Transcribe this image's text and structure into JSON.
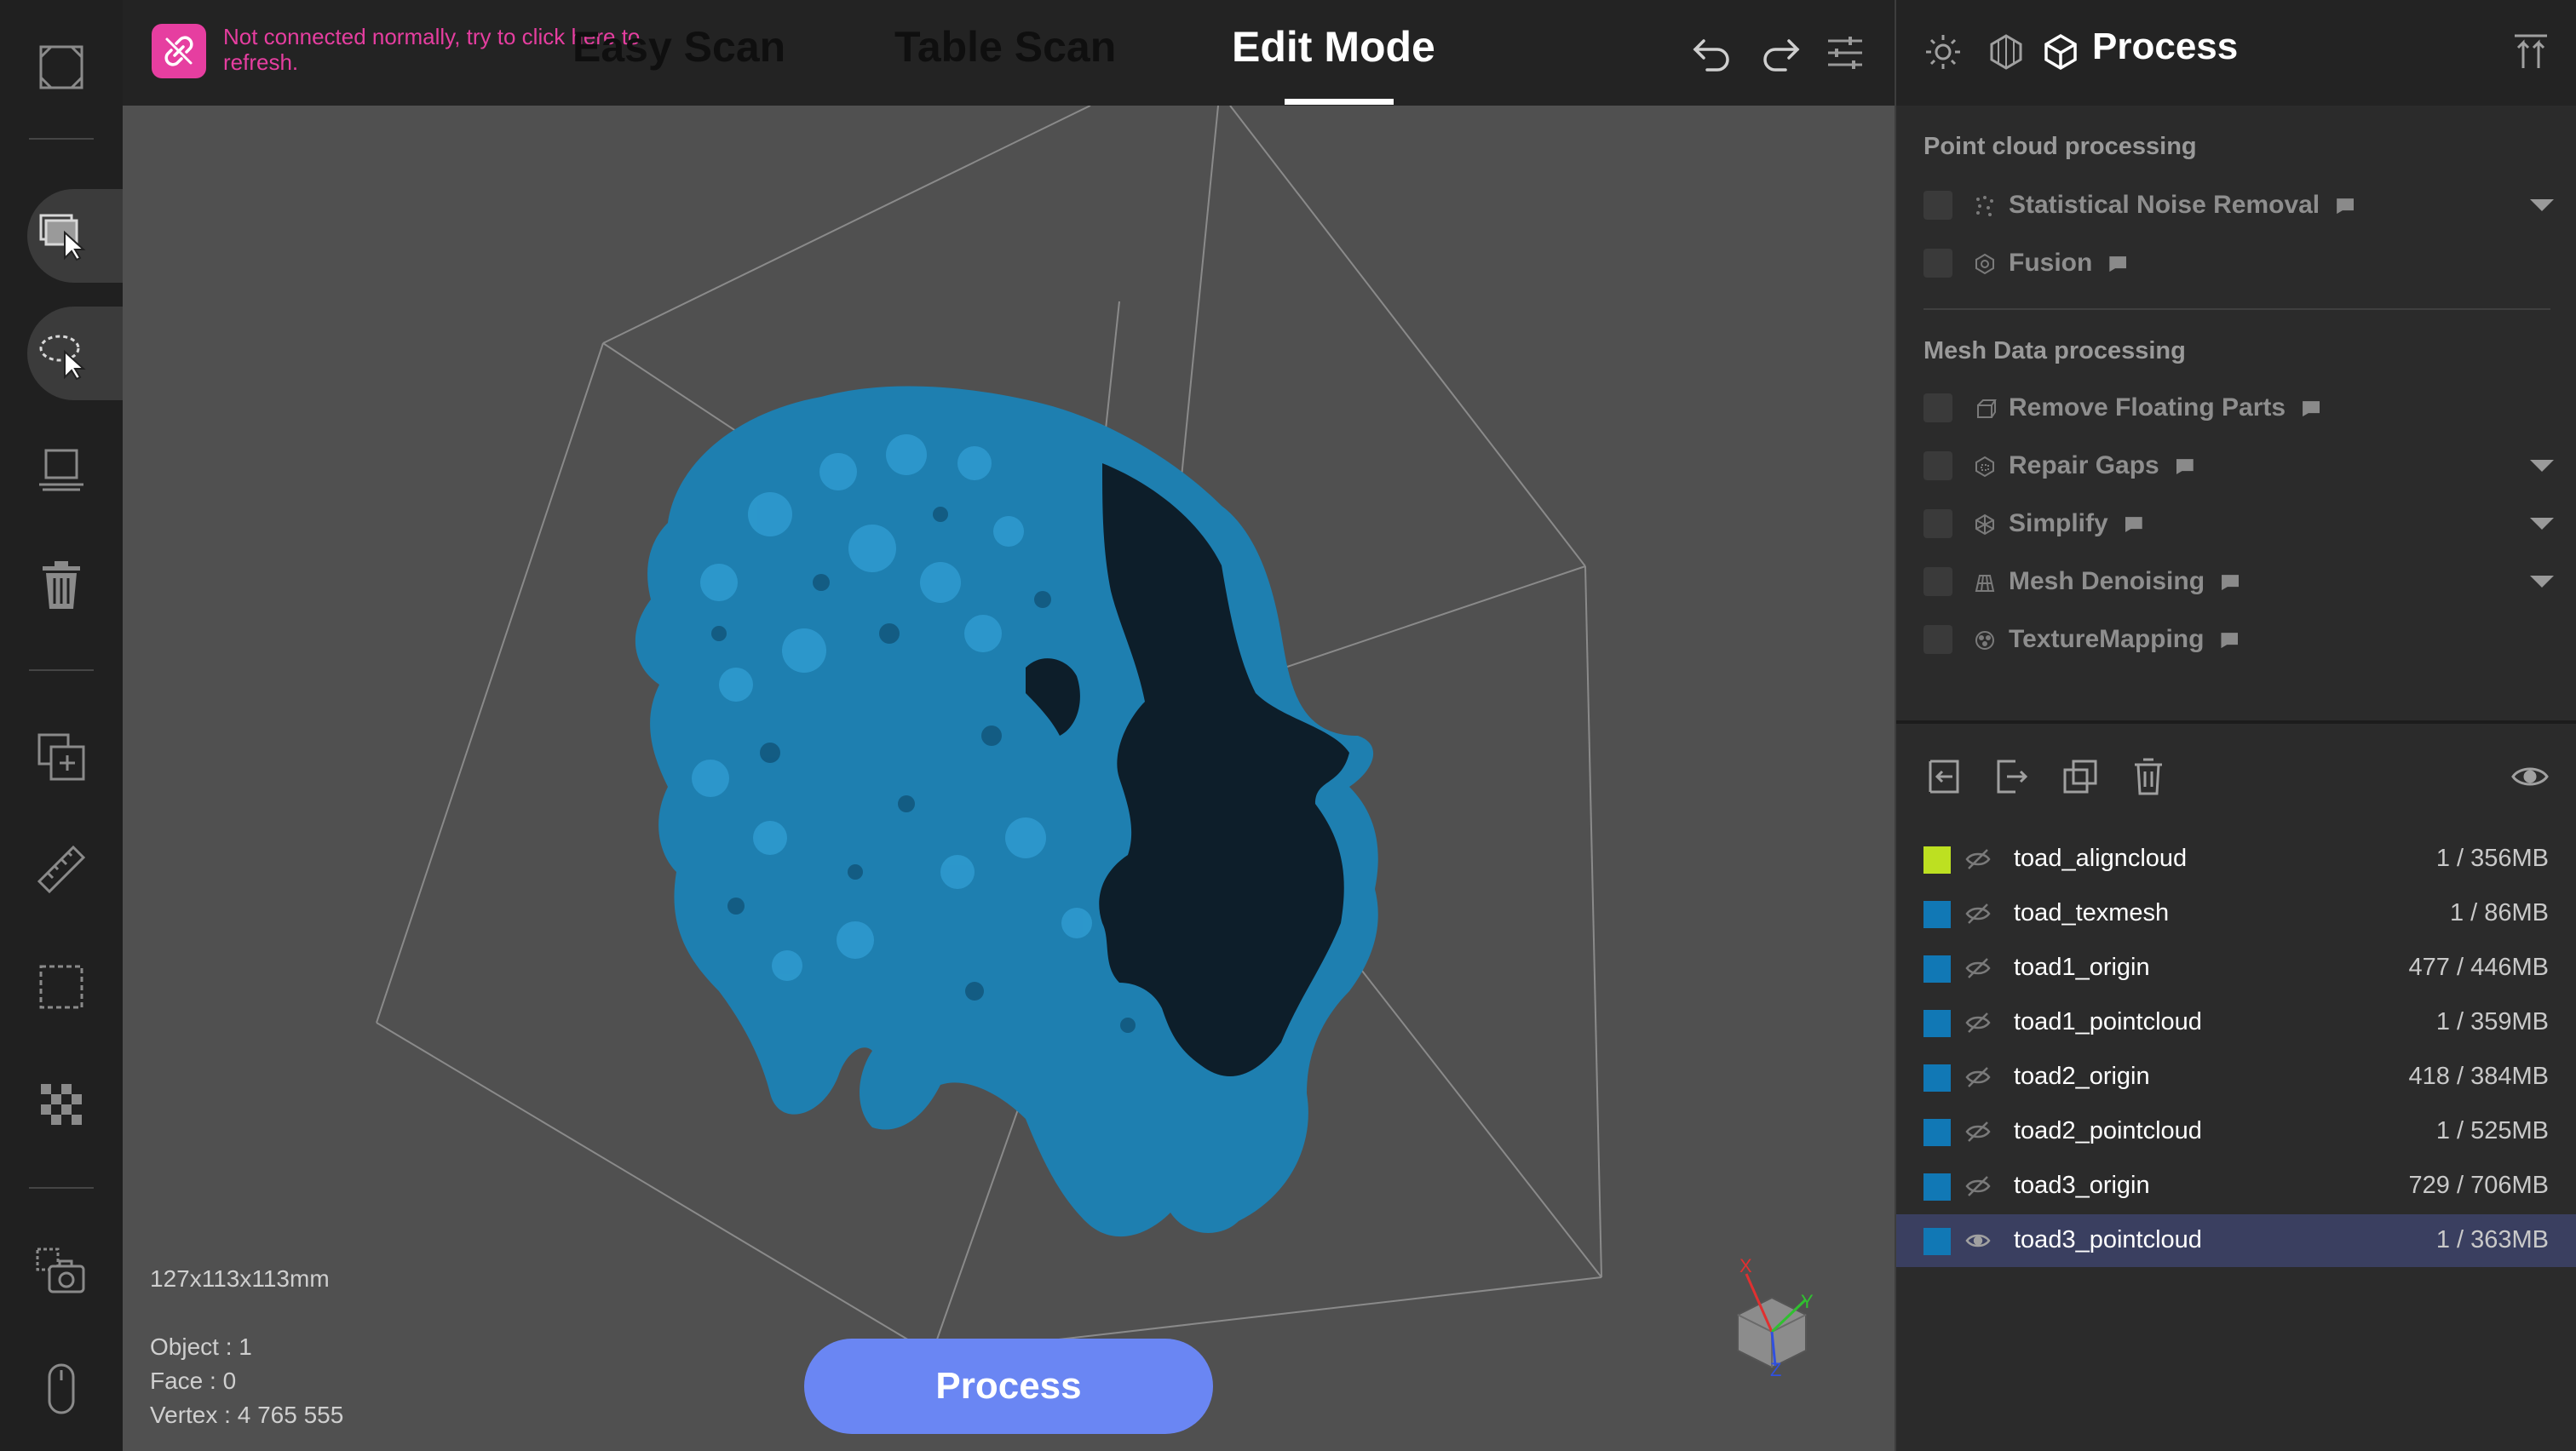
{
  "connection": {
    "message": "Not connected normally, try to click here to refresh.",
    "icon": "broken-link-icon",
    "color": "#e63ea0"
  },
  "modes": {
    "easy_scan": "Easy Scan",
    "table_scan": "Table Scan",
    "edit_mode": "Edit Mode",
    "active": "Edit Mode"
  },
  "toolbar": {
    "icons": [
      "fit-view-icon",
      "select-icon",
      "lasso-select-icon",
      "plane-cut-icon",
      "delete-icon",
      "add-layer-icon",
      "ruler-icon",
      "crop-box-icon",
      "checkerboard-icon",
      "snapshot-icon",
      "mouse-icon"
    ],
    "top_icons": [
      "undo-icon",
      "redo-icon",
      "settings-sliders-icon"
    ]
  },
  "viewport": {
    "dimensions": "127x113x113mm",
    "object_label": "Object : 1",
    "face_label": "Face : 0",
    "vertex_label": "Vertex : 4 765 555",
    "process_button": "Process",
    "model_color": "#1e7fb0",
    "background": "#505050",
    "axes": {
      "x": "X",
      "y": "Y",
      "z": "Z"
    }
  },
  "panel": {
    "title": "Process",
    "header_icons": [
      "sun-icon",
      "texture-icon",
      "cube-icon",
      "upload-icon"
    ],
    "point_cloud": {
      "title": "Point cloud processing",
      "items": [
        {
          "label": "Statistical Noise Removal",
          "icon": "noise-icon",
          "has_dropdown": true
        },
        {
          "label": "Fusion",
          "icon": "fusion-icon",
          "has_dropdown": false
        }
      ]
    },
    "mesh": {
      "title": "Mesh Data processing",
      "items": [
        {
          "label": "Remove Floating Parts",
          "icon": "floating-parts-icon",
          "has_dropdown": false
        },
        {
          "label": "Repair Gaps",
          "icon": "repair-gaps-icon",
          "has_dropdown": true
        },
        {
          "label": "Simplify",
          "icon": "simplify-icon",
          "has_dropdown": true
        },
        {
          "label": "Mesh Denoising",
          "icon": "mesh-denoise-icon",
          "has_dropdown": true
        },
        {
          "label": "TextureMapping",
          "icon": "texture-mapping-icon",
          "has_dropdown": false
        }
      ]
    },
    "object_actions": [
      "import-icon",
      "export-icon",
      "duplicate-icon",
      "trash-icon",
      "eye-icon"
    ],
    "layers": [
      {
        "name": "toad_aligncloud",
        "size": "1 / 356MB",
        "color": "#bde021",
        "visible": false
      },
      {
        "name": "toad_texmesh",
        "size": "1 / 86MB",
        "color": "#1178b5",
        "visible": false
      },
      {
        "name": "toad1_origin",
        "size": "477 / 446MB",
        "color": "#1178b5",
        "visible": false
      },
      {
        "name": "toad1_pointcloud",
        "size": "1 / 359MB",
        "color": "#1178b5",
        "visible": false
      },
      {
        "name": "toad2_origin",
        "size": "418 / 384MB",
        "color": "#1178b5",
        "visible": false
      },
      {
        "name": "toad2_pointcloud",
        "size": "1 / 525MB",
        "color": "#1178b5",
        "visible": false
      },
      {
        "name": "toad3_origin",
        "size": "729 / 706MB",
        "color": "#1178b5",
        "visible": false
      },
      {
        "name": "toad3_pointcloud",
        "size": "1 / 363MB",
        "color": "#1178b5",
        "visible": true,
        "selected": true
      }
    ]
  }
}
